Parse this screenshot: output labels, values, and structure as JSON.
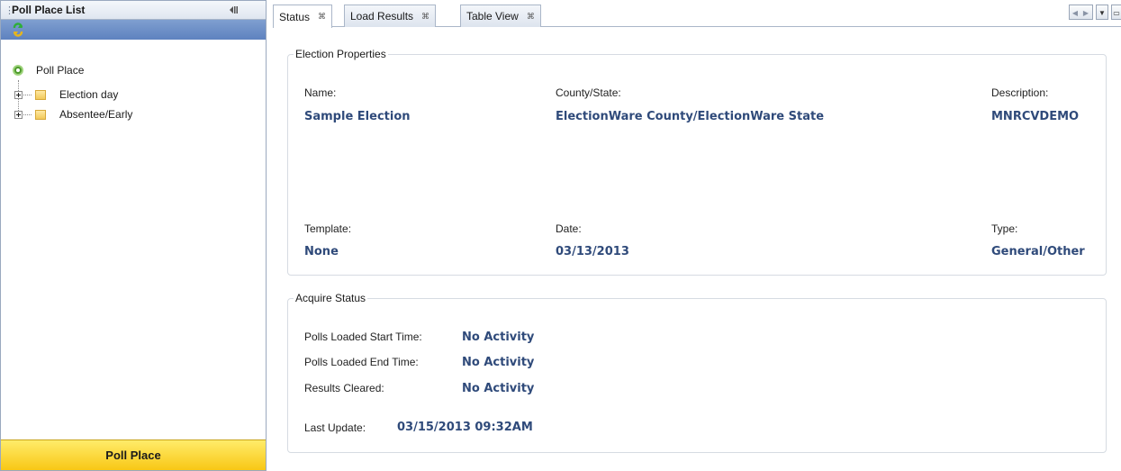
{
  "left_panel": {
    "title": "Poll Place List",
    "root_label": "Poll Place",
    "nodes": [
      {
        "label": "Election day"
      },
      {
        "label": "Absentee/Early"
      }
    ],
    "bottom_button": "Poll Place"
  },
  "tabs": [
    {
      "label": "Status",
      "active": true
    },
    {
      "label": "Load Results",
      "active": false
    },
    {
      "label": "Table View",
      "active": false
    }
  ],
  "election_properties": {
    "title": "Election Properties",
    "name_label": "Name:",
    "name_value": "Sample Election",
    "county_label": "County/State:",
    "county_value": "ElectionWare County/ElectionWare State",
    "description_label": "Description:",
    "description_value": "MNRCVDEMO",
    "template_label": "Template:",
    "template_value": "None",
    "date_label": "Date:",
    "date_value": "03/13/2013",
    "type_label": "Type:",
    "type_value": "General/Other"
  },
  "acquire_status": {
    "title": "Acquire Status",
    "start_label": "Polls Loaded Start Time:",
    "start_value": "No Activity",
    "end_label": "Polls Loaded End Time:",
    "end_value": "No Activity",
    "cleared_label": "Results Cleared:",
    "cleared_value": "No Activity",
    "last_update_label": "Last Update:",
    "last_update_value": "03/15/2013 09:32AM"
  },
  "colors": {
    "value_text": "#2f4a7a",
    "bottom_button": "#f8c715",
    "toolbar": "#5e82bf"
  },
  "icons": [
    "refresh-icon",
    "collapse-panel-icon",
    "poll-place-root-icon",
    "folder-icon",
    "expand-icon",
    "close-tab-icon",
    "scroll-left-icon",
    "scroll-right-icon",
    "tab-list-icon",
    "maximize-icon"
  ]
}
